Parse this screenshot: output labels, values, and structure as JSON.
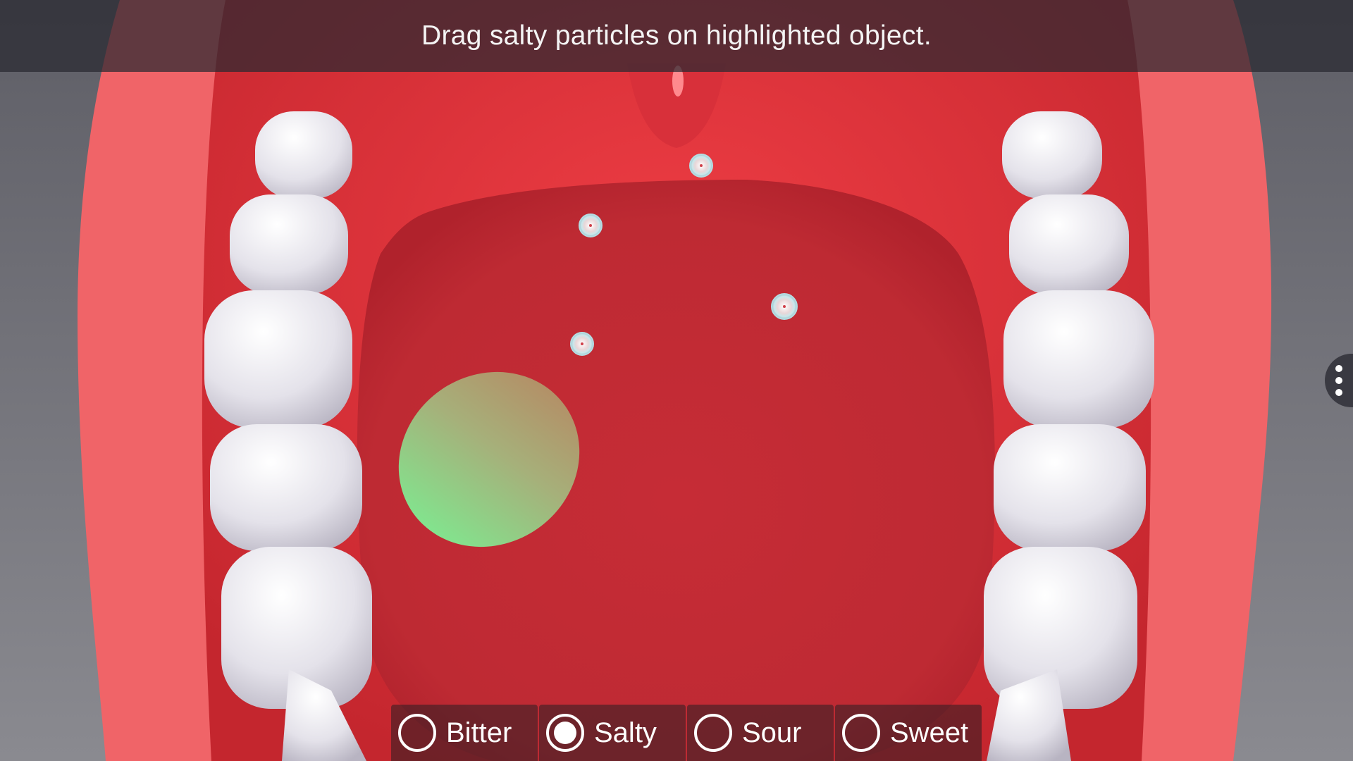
{
  "instruction": "Drag salty particles on highlighted object.",
  "colors": {
    "lip": "#f26a6e",
    "mouth_cavity": "#e83a40",
    "tongue": "#c42c36",
    "highlight_zone": "#7ed28a",
    "tooth": "#e8e6ec",
    "background": "#7a7a80"
  },
  "particles": {
    "kind": "salty",
    "count": 4,
    "icon": "salt-particle-icon"
  },
  "menu": {
    "icon": "more-vertical-icon"
  },
  "taste_options": [
    {
      "label": "Bitter",
      "selected": false
    },
    {
      "label": "Salty",
      "selected": true
    },
    {
      "label": "Sour",
      "selected": false
    },
    {
      "label": "Sweet",
      "selected": false
    }
  ]
}
